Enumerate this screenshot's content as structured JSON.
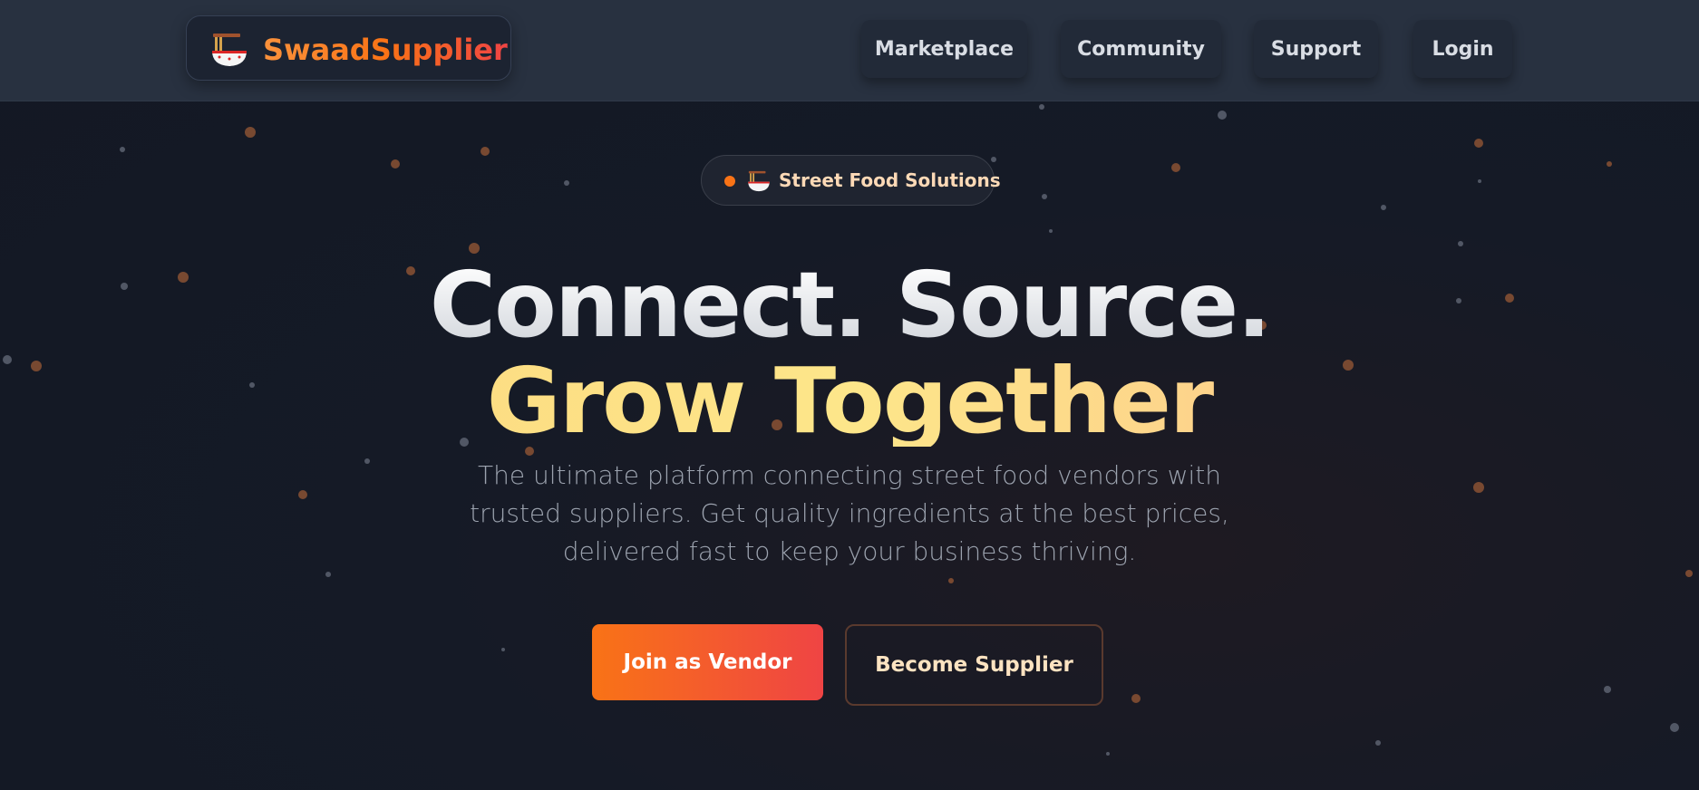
{
  "brand": {
    "name": "SwaadSupplier",
    "icon": "noodle-bowl-icon"
  },
  "nav": {
    "items": [
      {
        "label": "Marketplace"
      },
      {
        "label": "Community"
      },
      {
        "label": "Support"
      },
      {
        "label": "Login"
      }
    ]
  },
  "hero": {
    "badge": {
      "text": "Street Food Solutions",
      "icon": "noodle-bowl-icon"
    },
    "headline_line1": "Connect. Source.",
    "headline_line2": "Grow Together",
    "subtitle": "The ultimate platform connecting street food vendors with trusted suppliers. Get quality ingredients at the best prices, delivered fast to keep your business thriving.",
    "primary_cta": "Join as Vendor",
    "secondary_cta": "Become Supplier"
  },
  "colors": {
    "accent_orange": "#f97316",
    "accent_red": "#ef4444",
    "nav_bg": "#283140",
    "page_bg": "#141925",
    "headline_gold": "#fde68a"
  }
}
